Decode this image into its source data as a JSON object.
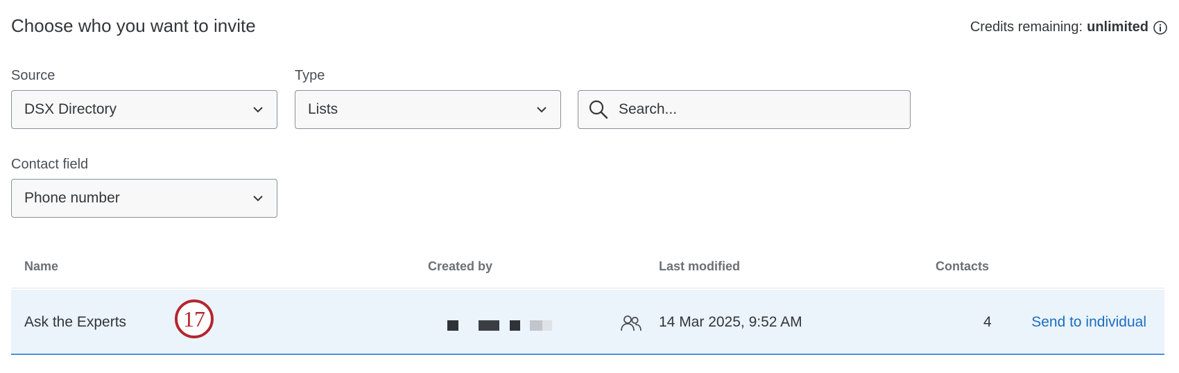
{
  "header": {
    "title": "Choose who you want to invite",
    "credits_label": "Credits remaining:",
    "credits_value": "unlimited"
  },
  "filters": {
    "source_label": "Source",
    "source_value": "DSX Directory",
    "type_label": "Type",
    "type_value": "Lists",
    "search_placeholder": "Search...",
    "contact_field_label": "Contact field",
    "contact_field_value": "Phone number"
  },
  "table": {
    "columns": [
      "Name",
      "Created by",
      "Last modified",
      "Contacts"
    ],
    "rows": [
      {
        "name": "Ask the Experts",
        "badge": "17",
        "last_modified": "14 Mar 2025, 9:52 AM",
        "contacts": "4",
        "action": "Send to individual"
      }
    ]
  },
  "colors": {
    "accent": "#1a6ec1",
    "row_highlight": "#ebf3fb",
    "badge": "#b4262e"
  },
  "icons": [
    "info-icon",
    "chevron-down-icon",
    "search-icon",
    "people-icon"
  ]
}
